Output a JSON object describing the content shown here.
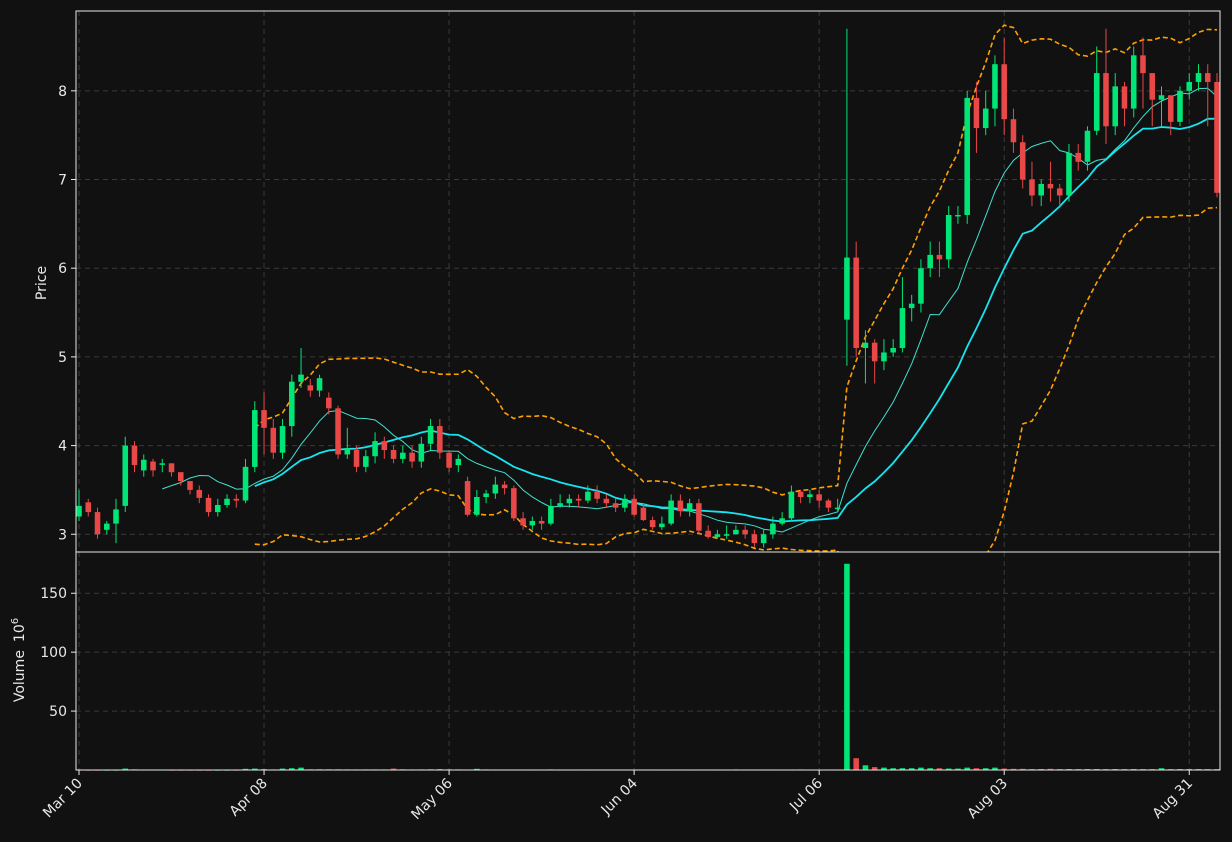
{
  "chart_data": {
    "type": "candlestick",
    "ylabel": "Price",
    "volume_label": "Volume",
    "volume_exponent": "6",
    "ylim": [
      2.8,
      8.9
    ],
    "volume_ylim": [
      0,
      185
    ],
    "y_ticks": [
      "3",
      "4",
      "5",
      "6",
      "7",
      "8"
    ],
    "volume_ticks": [
      "50",
      "100",
      "150"
    ],
    "x_ticks": [
      "Mar 10",
      "Apr 08",
      "May 06",
      "Jun 04",
      "Jul 06",
      "Aug 03",
      "Aug 31"
    ],
    "grid": true,
    "colors": {
      "background": "#111111",
      "up": "#00e676",
      "down": "#e84848",
      "ma_fast": "#40e0d0",
      "ma_slow": "#18e4f0",
      "bands": "#ffa000",
      "grid": "#3a3a3a"
    },
    "close": [
      3.32,
      3.25,
      3.0,
      3.12,
      3.28,
      4.0,
      3.78,
      3.84,
      3.72,
      3.8,
      3.7,
      3.6,
      3.5,
      3.41,
      3.25,
      3.33,
      3.4,
      3.38,
      3.76,
      4.4,
      4.2,
      3.92,
      4.22,
      4.72,
      4.8,
      4.62,
      4.76,
      4.42,
      3.9,
      3.97,
      3.76,
      3.88,
      4.05,
      3.95,
      3.85,
      3.92,
      3.82,
      4.02,
      4.22,
      3.92,
      3.75,
      3.85,
      3.22,
      3.42,
      3.46,
      3.56,
      3.52,
      3.18,
      3.1,
      3.15,
      3.12,
      3.32,
      3.35,
      3.4,
      3.38,
      3.48,
      3.4,
      3.35,
      3.3,
      3.4,
      3.22,
      3.16,
      3.08,
      3.12,
      3.38,
      3.26,
      3.35,
      3.04,
      2.97,
      3.0,
      3.0,
      3.05,
      3.0,
      2.9,
      3.0,
      3.12,
      3.18,
      3.48,
      3.42,
      3.45,
      3.38,
      3.3,
      3.3,
      6.12,
      5.1,
      5.16,
      4.95,
      5.05,
      5.1,
      5.55,
      5.6,
      6.0,
      6.15,
      6.1,
      6.6,
      6.6,
      7.92,
      7.58,
      7.8,
      8.3,
      7.68,
      7.42,
      7.0,
      6.82,
      6.95,
      6.9,
      6.82,
      7.3,
      7.2,
      7.55,
      8.2,
      7.6,
      8.05,
      7.8,
      8.4,
      8.2,
      7.9,
      7.95,
      7.65,
      8.0,
      8.1,
      8.2,
      8.1,
      6.85
    ],
    "open": [
      3.2,
      3.36,
      3.25,
      3.05,
      3.12,
      3.32,
      4.0,
      3.72,
      3.82,
      3.8,
      3.8,
      3.7,
      3.6,
      3.5,
      3.41,
      3.25,
      3.33,
      3.4,
      3.38,
      3.76,
      4.4,
      4.2,
      3.92,
      4.22,
      4.72,
      4.68,
      4.62,
      4.54,
      4.42,
      3.9,
      3.95,
      3.76,
      3.88,
      4.05,
      3.95,
      3.85,
      3.92,
      3.82,
      4.02,
      4.22,
      3.92,
      3.78,
      3.6,
      3.22,
      3.42,
      3.46,
      3.56,
      3.52,
      3.18,
      3.1,
      3.15,
      3.12,
      3.32,
      3.35,
      3.4,
      3.38,
      3.48,
      3.4,
      3.35,
      3.3,
      3.4,
      3.3,
      3.16,
      3.08,
      3.12,
      3.38,
      3.26,
      3.35,
      3.04,
      2.97,
      3.0,
      3.0,
      3.05,
      3.0,
      2.9,
      3.0,
      3.12,
      3.18,
      3.48,
      3.42,
      3.45,
      3.38,
      3.3,
      5.42,
      6.12,
      5.1,
      5.16,
      4.95,
      5.05,
      5.1,
      5.55,
      5.6,
      6.0,
      6.15,
      6.1,
      6.6,
      6.6,
      7.92,
      7.58,
      7.8,
      8.3,
      7.68,
      7.42,
      7.0,
      6.82,
      6.95,
      6.9,
      6.82,
      7.3,
      7.2,
      7.55,
      8.2,
      7.6,
      8.05,
      7.8,
      8.4,
      8.2,
      7.9,
      7.95,
      7.65,
      8.0,
      8.1,
      8.2,
      8.1
    ],
    "high": [
      3.5,
      3.4,
      3.3,
      3.15,
      3.4,
      4.1,
      4.05,
      3.9,
      3.85,
      3.85,
      3.8,
      3.7,
      3.6,
      3.55,
      3.45,
      3.4,
      3.45,
      3.45,
      3.85,
      4.5,
      4.6,
      4.3,
      4.3,
      4.8,
      5.1,
      4.75,
      4.8,
      4.6,
      4.45,
      4.2,
      4.0,
      3.95,
      4.15,
      4.1,
      4.0,
      4.0,
      4.0,
      4.1,
      4.3,
      4.3,
      3.95,
      3.9,
      3.65,
      3.5,
      3.5,
      3.65,
      3.6,
      3.55,
      3.25,
      3.2,
      3.2,
      3.4,
      3.45,
      3.45,
      3.45,
      3.55,
      3.55,
      3.45,
      3.4,
      3.45,
      3.45,
      3.35,
      3.2,
      3.2,
      3.45,
      3.45,
      3.4,
      3.4,
      3.1,
      3.05,
      3.1,
      3.1,
      3.1,
      3.05,
      3.05,
      3.2,
      3.25,
      3.55,
      3.5,
      3.5,
      3.5,
      3.4,
      3.4,
      8.7,
      6.3,
      5.3,
      5.2,
      5.2,
      5.2,
      5.9,
      5.7,
      6.1,
      6.3,
      6.3,
      6.7,
      6.7,
      8.0,
      8.1,
      8.0,
      8.4,
      8.6,
      7.8,
      7.5,
      7.2,
      7.0,
      7.2,
      6.95,
      7.4,
      7.4,
      7.6,
      8.5,
      8.7,
      8.2,
      8.1,
      8.5,
      8.6,
      8.0,
      8.05,
      7.9,
      8.05,
      8.2,
      8.3,
      8.3,
      8.2
    ],
    "low": [
      3.15,
      3.2,
      2.95,
      3.0,
      2.9,
      3.25,
      3.7,
      3.65,
      3.65,
      3.7,
      3.65,
      3.55,
      3.45,
      3.35,
      3.2,
      3.2,
      3.3,
      3.3,
      3.35,
      3.7,
      3.9,
      3.85,
      3.85,
      4.1,
      4.65,
      4.55,
      4.55,
      4.35,
      3.85,
      3.85,
      3.7,
      3.7,
      3.8,
      3.85,
      3.8,
      3.8,
      3.75,
      3.75,
      3.95,
      3.85,
      3.7,
      3.7,
      3.2,
      3.2,
      3.35,
      3.4,
      3.45,
      3.15,
      3.05,
      3.05,
      3.05,
      3.1,
      3.3,
      3.3,
      3.3,
      3.35,
      3.35,
      3.3,
      3.25,
      3.25,
      3.2,
      3.15,
      3.05,
      3.05,
      3.1,
      3.2,
      3.2,
      3.0,
      2.95,
      2.95,
      2.95,
      3.0,
      2.95,
      2.85,
      2.85,
      2.95,
      3.1,
      3.15,
      3.35,
      3.35,
      3.3,
      3.25,
      3.25,
      4.9,
      5.0,
      4.7,
      4.7,
      4.85,
      5.0,
      5.05,
      5.4,
      5.5,
      5.9,
      5.9,
      6.0,
      6.5,
      6.5,
      7.3,
      7.5,
      7.6,
      7.5,
      7.3,
      6.9,
      6.7,
      6.7,
      6.75,
      6.7,
      6.75,
      7.1,
      7.1,
      7.5,
      7.4,
      7.5,
      7.6,
      7.7,
      7.8,
      7.6,
      7.6,
      7.5,
      7.6,
      7.9,
      8.0,
      7.6,
      6.8
    ],
    "volume": [
      0.5,
      0.3,
      0.3,
      0.3,
      0.3,
      1.2,
      0.6,
      0.4,
      0.4,
      0.4,
      0.3,
      0.3,
      0.3,
      0.3,
      0.3,
      0.3,
      0.3,
      0.3,
      1.0,
      1.2,
      0.8,
      0.5,
      1.2,
      1.5,
      2.0,
      0.6,
      0.6,
      0.6,
      0.6,
      0.5,
      0.5,
      0.5,
      0.5,
      0.5,
      1.2,
      0.6,
      0.5,
      0.5,
      0.6,
      0.8,
      0.6,
      0.5,
      0.4,
      1.0,
      0.5,
      0.4,
      0.4,
      0.4,
      0.4,
      0.4,
      0.4,
      0.5,
      0.4,
      0.4,
      0.4,
      0.4,
      0.4,
      0.4,
      0.4,
      0.4,
      0.4,
      0.4,
      0.4,
      0.4,
      0.4,
      0.4,
      0.4,
      0.4,
      0.4,
      0.4,
      0.4,
      0.5,
      0.4,
      0.4,
      0.4,
      0.4,
      0.4,
      0.4,
      0.5,
      0.4,
      0.4,
      0.4,
      0.4,
      175,
      10,
      4,
      2.5,
      2,
      1.5,
      1.5,
      1.5,
      2,
      1.5,
      1.5,
      1.2,
      1.2,
      2,
      1.5,
      1.5,
      2,
      1.2,
      1,
      1,
      0.8,
      0.8,
      1,
      0.8,
      0.8,
      0.8,
      0.8,
      0.8,
      0.8,
      0.8,
      0.8,
      0.8,
      0.8,
      0.8,
      1.5,
      0.8,
      0.8,
      0.8,
      0.8,
      0.8,
      0.8,
      0.8,
      0.8
    ]
  }
}
